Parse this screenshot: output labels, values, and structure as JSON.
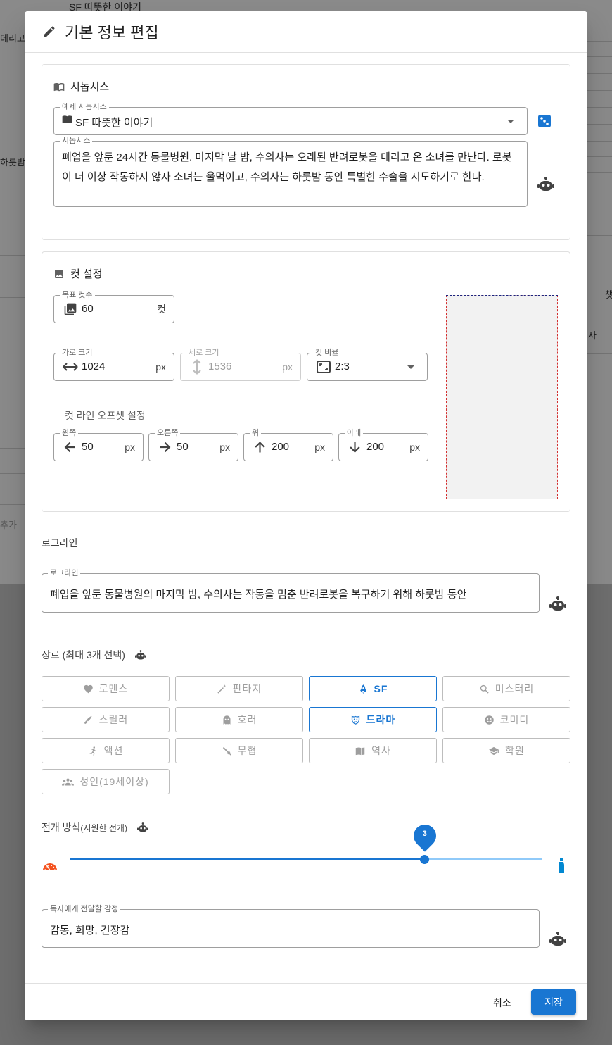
{
  "background": {
    "select_value": "SF 따뜻한 이야기",
    "text_a": "데리고",
    "text_b": "하룻밤",
    "text_c": "추가",
    "text_d": "챗",
    "text_e": "사"
  },
  "dialog": {
    "title": "기본 정보 편집",
    "synopsis_section": {
      "heading": "시놉시스",
      "example_label": "예제 시놉시스",
      "example_value": "SF 따뜻한 이야기",
      "synopsis_label": "시놉시스",
      "synopsis_text": "폐업을 앞둔 24시간 동물병원. 마지막 날 밤, 수의사는 오래된 반려로봇을 데리고 온 소녀를 만난다. 로봇이 더 이상 작동하지 않자 소녀는 울먹이고, 수의사는 하룻밤 동안 특별한 수술을 시도하기로 한다."
    },
    "cut_section": {
      "heading": "컷 설정",
      "target_label": "목표 컷수",
      "target_value": "60",
      "target_unit": "컷",
      "width_label": "가로 크기",
      "width_value": "1024",
      "height_label": "세로 크기",
      "height_value": "1536",
      "unit_px": "px",
      "ratio_label": "컷 비율",
      "ratio_value": "2:3",
      "offset_heading": "컷 라인 오프셋 설정",
      "left_label": "왼쪽",
      "left_value": "50",
      "right_label": "오른쪽",
      "right_value": "50",
      "top_label": "위",
      "top_value": "200",
      "bottom_label": "아래",
      "bottom_value": "200"
    },
    "logline": {
      "heading": "로그라인",
      "label": "로그라인",
      "value": "폐업을 앞둔 동물병원의 마지막 밤, 수의사는 작동을 멈춘 반려로봇을 복구하기 위해 하룻밤 동안"
    },
    "genre": {
      "heading": "장르 (최대 3개 선택)",
      "chips": [
        {
          "label": "로맨스",
          "icon": "heart-icon",
          "selected": false
        },
        {
          "label": "판타지",
          "icon": "magic-wand-icon",
          "selected": false
        },
        {
          "label": "SF",
          "icon": "rocket-icon",
          "selected": true
        },
        {
          "label": "미스터리",
          "icon": "search-icon",
          "selected": false
        },
        {
          "label": "스릴러",
          "icon": "knife-icon",
          "selected": false
        },
        {
          "label": "호러",
          "icon": "ghost-icon",
          "selected": false
        },
        {
          "label": "드라마",
          "icon": "theater-mask-icon",
          "selected": true
        },
        {
          "label": "코미디",
          "icon": "smile-icon",
          "selected": false
        },
        {
          "label": "액션",
          "icon": "running-icon",
          "selected": false
        },
        {
          "label": "무협",
          "icon": "sword-icon",
          "selected": false
        },
        {
          "label": "역사",
          "icon": "book-icon",
          "selected": false
        },
        {
          "label": "학원",
          "icon": "school-icon",
          "selected": false
        },
        {
          "label": "성인(19세이상)",
          "icon": "group-icon",
          "selected": false
        }
      ]
    },
    "pacing": {
      "heading": "전개 방식",
      "heading_sub": "(시원한 전개)",
      "value": "3",
      "fraction": 0.752
    },
    "emotion": {
      "label": "독자에게 전달할 감정",
      "value": "감동, 희망, 긴장감"
    },
    "footer": {
      "cancel": "취소",
      "save": "저장"
    }
  },
  "colors": {
    "primary": "#1976d2",
    "selected_chip": "#1976d2",
    "slow_icon": "#f4511e",
    "fast_icon": "#0288d1"
  }
}
